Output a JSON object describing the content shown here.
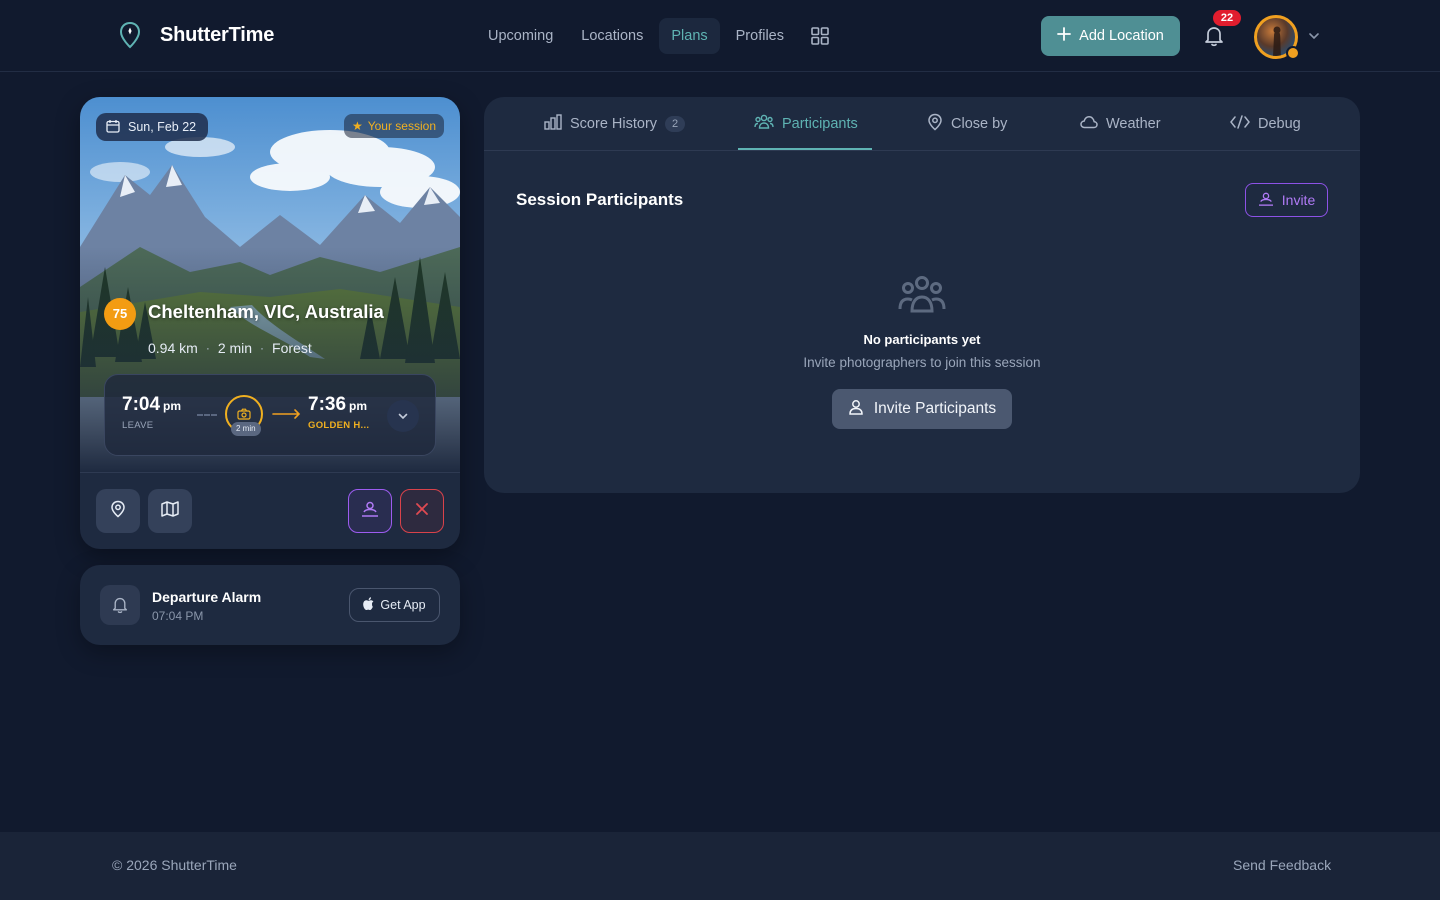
{
  "brand": {
    "name": "ShutterTime"
  },
  "nav": {
    "items": [
      {
        "label": "Upcoming",
        "active": false
      },
      {
        "label": "Locations",
        "active": false
      },
      {
        "label": "Plans",
        "active": true
      },
      {
        "label": "Profiles",
        "active": false
      }
    ],
    "grid_icon": "grid-icon"
  },
  "header": {
    "add_location_label": "Add Location",
    "notification_count": "22",
    "accent_color": "#4f8f94"
  },
  "session": {
    "date": "Sun, Feb 22",
    "tag": "Your session",
    "score": "75",
    "location": "Cheltenham, VIC, Australia",
    "distance": "0.94 km",
    "duration": "2 min",
    "terrain": "Forest",
    "leave_time": "7:04",
    "leave_ampm": "pm",
    "leave_label": "LEAVE",
    "travel_pill": "2 min",
    "event_time": "7:36",
    "event_ampm": "pm",
    "event_label": "GOLDEN H..."
  },
  "alarm": {
    "title": "Departure Alarm",
    "time": "07:04 PM",
    "get_app_label": "Get App"
  },
  "tabs": [
    {
      "label": "Score History",
      "count": "2",
      "icon": "bar-chart-icon"
    },
    {
      "label": "Participants",
      "icon": "users-icon",
      "active": true
    },
    {
      "label": "Close by",
      "icon": "map-pin-icon"
    },
    {
      "label": "Weather",
      "icon": "cloud-icon"
    },
    {
      "label": "Debug",
      "icon": "code-icon"
    }
  ],
  "participants": {
    "title": "Session Participants",
    "invite_label": "Invite",
    "empty_title": "No participants yet",
    "empty_subtitle": "Invite photographers to join this session",
    "invite_button_label": "Invite Participants"
  },
  "footer": {
    "copyright": "© 2026 ShutterTime",
    "feedback": "Send Feedback"
  }
}
